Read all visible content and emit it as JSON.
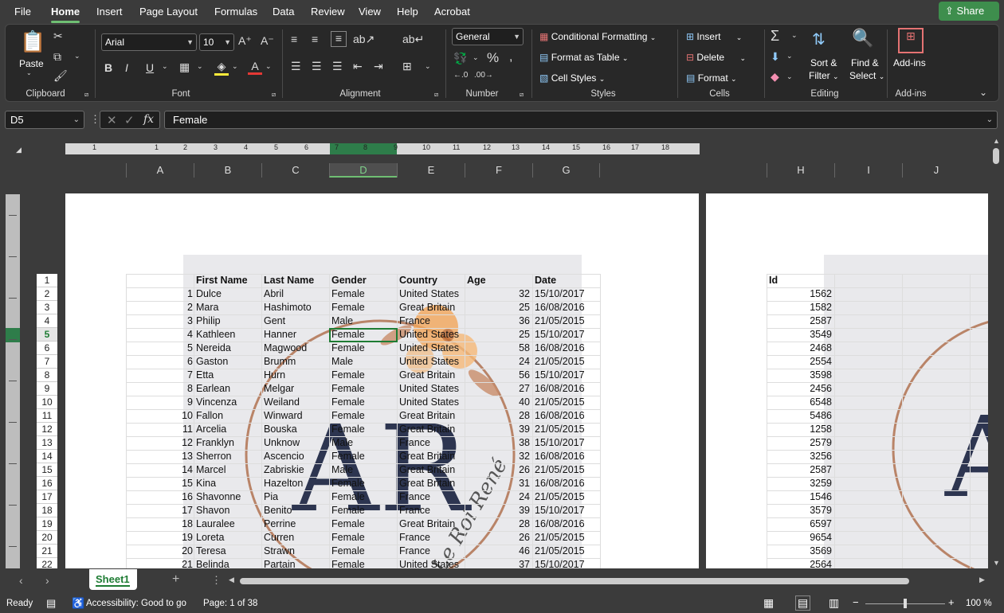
{
  "menu": {
    "file": "File",
    "home": "Home",
    "insert": "Insert",
    "page_layout": "Page Layout",
    "formulas": "Formulas",
    "data": "Data",
    "review": "Review",
    "view": "View",
    "help": "Help",
    "acrobat": "Acrobat",
    "share": "Share"
  },
  "ribbon": {
    "clipboard": {
      "paste": "Paste",
      "label": "Clipboard"
    },
    "font": {
      "name": "Arial",
      "size": "10",
      "bold": "B",
      "italic": "I",
      "underline": "U",
      "label": "Font"
    },
    "alignment": {
      "label": "Alignment"
    },
    "number": {
      "format": "General",
      "label": "Number"
    },
    "styles": {
      "conditional": "Conditional Formatting",
      "format_table": "Format as Table",
      "cell_styles": "Cell Styles",
      "label": "Styles"
    },
    "cells": {
      "insert": "Insert",
      "delete": "Delete",
      "format": "Format",
      "label": "Cells"
    },
    "editing": {
      "sort_filter_1": "Sort &",
      "sort_filter_2": "Filter",
      "find_select_1": "Find &",
      "find_select_2": "Select",
      "label": "Editing"
    },
    "addins": {
      "btn": "Add-ins",
      "label": "Add-ins"
    }
  },
  "formula_bar": {
    "name_box": "D5",
    "value": "Female"
  },
  "column_headers": [
    "A",
    "B",
    "C",
    "D",
    "E",
    "F",
    "G",
    "H",
    "I",
    "J"
  ],
  "ruler_numbers": [
    "1",
    "1",
    "2",
    "3",
    "4",
    "5",
    "6",
    "7",
    "8",
    "9",
    "10",
    "11",
    "12",
    "13",
    "14",
    "15",
    "16",
    "17",
    "18"
  ],
  "header_row": [
    "First Name",
    "Last Name",
    "Gender",
    "Country",
    "Age",
    "Date"
  ],
  "id_header": "Id",
  "rows": [
    [
      "1",
      "Dulce",
      "Abril",
      "Female",
      "United States",
      "32",
      "15/10/2017",
      "1562"
    ],
    [
      "2",
      "Mara",
      "Hashimoto",
      "Female",
      "Great Britain",
      "25",
      "16/08/2016",
      "1582"
    ],
    [
      "3",
      "Philip",
      "Gent",
      "Male",
      "France",
      "36",
      "21/05/2015",
      "2587"
    ],
    [
      "4",
      "Kathleen",
      "Hanner",
      "Female",
      "United States",
      "25",
      "15/10/2017",
      "3549"
    ],
    [
      "5",
      "Nereida",
      "Magwood",
      "Female",
      "United States",
      "58",
      "16/08/2016",
      "2468"
    ],
    [
      "6",
      "Gaston",
      "Brumm",
      "Male",
      "United States",
      "24",
      "21/05/2015",
      "2554"
    ],
    [
      "7",
      "Etta",
      "Hurn",
      "Female",
      "Great Britain",
      "56",
      "15/10/2017",
      "3598"
    ],
    [
      "8",
      "Earlean",
      "Melgar",
      "Female",
      "United States",
      "27",
      "16/08/2016",
      "2456"
    ],
    [
      "9",
      "Vincenza",
      "Weiland",
      "Female",
      "United States",
      "40",
      "21/05/2015",
      "6548"
    ],
    [
      "10",
      "Fallon",
      "Winward",
      "Female",
      "Great Britain",
      "28",
      "16/08/2016",
      "5486"
    ],
    [
      "11",
      "Arcelia",
      "Bouska",
      "Female",
      "Great Britain",
      "39",
      "21/05/2015",
      "1258"
    ],
    [
      "12",
      "Franklyn",
      "Unknow",
      "Male",
      "France",
      "38",
      "15/10/2017",
      "2579"
    ],
    [
      "13",
      "Sherron",
      "Ascencio",
      "Female",
      "Great Britain",
      "32",
      "16/08/2016",
      "3256"
    ],
    [
      "14",
      "Marcel",
      "Zabriskie",
      "Male",
      "Great Britain",
      "26",
      "21/05/2015",
      "2587"
    ],
    [
      "15",
      "Kina",
      "Hazelton",
      "Female",
      "Great Britain",
      "31",
      "16/08/2016",
      "3259"
    ],
    [
      "16",
      "Shavonne",
      "Pia",
      "Female",
      "France",
      "24",
      "21/05/2015",
      "1546"
    ],
    [
      "17",
      "Shavon",
      "Benito",
      "Female",
      "France",
      "39",
      "15/10/2017",
      "3579"
    ],
    [
      "18",
      "Lauralee",
      "Perrine",
      "Female",
      "Great Britain",
      "28",
      "16/08/2016",
      "6597"
    ],
    [
      "19",
      "Loreta",
      "Curren",
      "Female",
      "France",
      "26",
      "21/05/2015",
      "9654"
    ],
    [
      "20",
      "Teresa",
      "Strawn",
      "Female",
      "France",
      "46",
      "21/05/2015",
      "3569"
    ],
    [
      "21",
      "Belinda",
      "Partain",
      "Female",
      "United States",
      "37",
      "15/10/2017",
      "2564"
    ]
  ],
  "row_numbers": [
    "1",
    "2",
    "3",
    "4",
    "5",
    "6",
    "7",
    "8",
    "9",
    "10",
    "11",
    "12",
    "13",
    "14",
    "15",
    "16",
    "17",
    "18",
    "19",
    "20",
    "21",
    "22"
  ],
  "watermark": {
    "initials": "AR",
    "text": "Le Roi René"
  },
  "sheet_tab": "Sheet1",
  "status": {
    "ready": "Ready",
    "accessibility": "Accessibility: Good to go",
    "page": "Page: 1 of 38",
    "zoom": "100 %"
  },
  "colors": {
    "accent": "#6fbf73",
    "share_bg": "#3e8e4d",
    "ribbon_bg": "#282828",
    "watermark_navy": "#2d3550",
    "watermark_ring": "#b98468"
  }
}
